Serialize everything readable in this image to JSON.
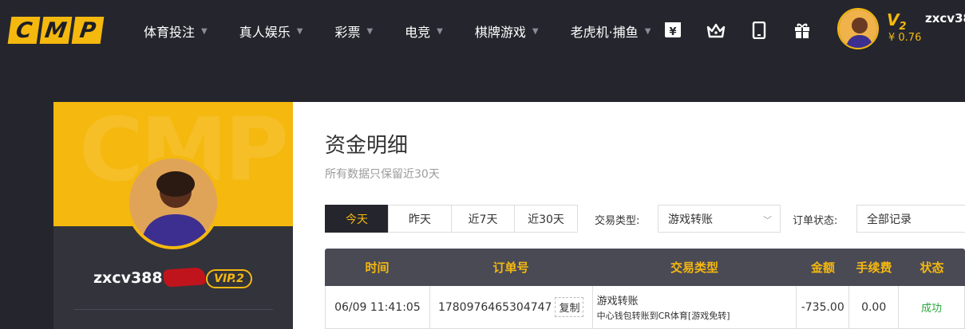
{
  "logo": {
    "letters": [
      "C",
      "M",
      "P"
    ],
    "brand_color": "#f5b80f"
  },
  "nav": {
    "items": [
      {
        "label": "体育投注"
      },
      {
        "label": "真人娱乐"
      },
      {
        "label": "彩票"
      },
      {
        "label": "电竞"
      },
      {
        "label": "棋牌游戏"
      },
      {
        "label": "老虎机·捕鱼"
      }
    ],
    "icons": [
      "yen-deposit-icon",
      "crown-icon",
      "mobile-icon",
      "gift-icon"
    ]
  },
  "user": {
    "vip_letter": "V",
    "vip_level": "2",
    "balance": "¥ 0.76",
    "username_top": "zxcv38",
    "username_profile": "zxcv388",
    "vip_badge": "VIP.2"
  },
  "banner_watermark": "CMP",
  "page": {
    "title": "资金明细",
    "subtitle": "所有数据只保留近30天"
  },
  "tabs": [
    {
      "label": "今天",
      "active": true
    },
    {
      "label": "昨天",
      "active": false
    },
    {
      "label": "近7天",
      "active": false
    },
    {
      "label": "近30天",
      "active": false
    }
  ],
  "filters": {
    "type_label": "交易类型:",
    "type_value": "游戏转账",
    "status_label": "订单状态:",
    "status_value": "全部记录"
  },
  "table": {
    "headers": [
      "时间",
      "订单号",
      "交易类型",
      "金额",
      "手续费",
      "状态"
    ],
    "rows": [
      {
        "time": "06/09 11:41:05",
        "order_no": "1780976465304747",
        "copy_label": "复制",
        "type_main": "游戏转账",
        "type_sub": "中心钱包转账到CR体育[游戏免转]",
        "amount": "-735.00",
        "fee": "0.00",
        "status": "成功"
      }
    ]
  }
}
